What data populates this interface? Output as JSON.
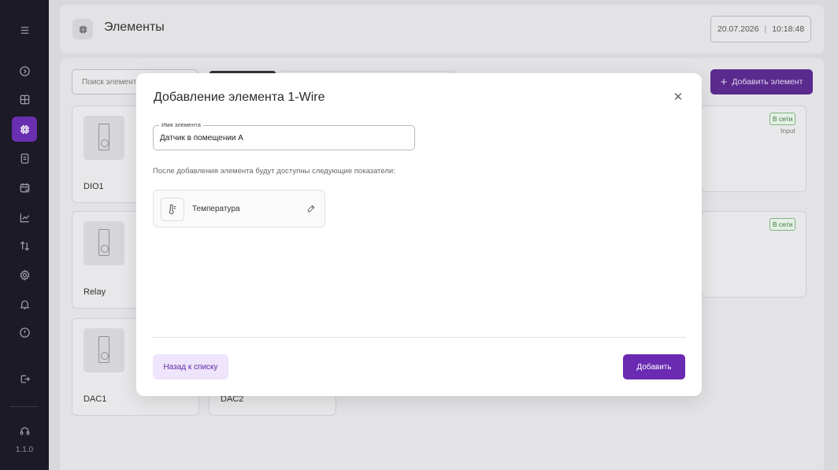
{
  "sidebar": {
    "items": [
      {
        "icon": "menu-icon"
      },
      {
        "icon": "arrow-circle-icon"
      },
      {
        "icon": "dashboard-icon"
      },
      {
        "icon": "chip-icon",
        "active": true
      },
      {
        "icon": "document-icon"
      },
      {
        "icon": "calendar-icon"
      },
      {
        "icon": "chart-icon"
      },
      {
        "icon": "transfer-icon"
      },
      {
        "icon": "settings-icon"
      },
      {
        "icon": "bell-icon"
      },
      {
        "icon": "info-icon"
      },
      {
        "icon": "logout-icon"
      },
      {
        "icon": "support-icon"
      }
    ],
    "version": "1.1.0"
  },
  "header": {
    "title": "Элементы",
    "date": "20.07.2026",
    "time": "10:18:48"
  },
  "toolbar": {
    "search_placeholder": "Поиск элемент",
    "add_label": "Добавить элемент"
  },
  "cards": [
    {
      "name": "DIO1"
    },
    {
      "name": "Relay"
    },
    {
      "name": "DAC1"
    },
    {
      "name": "DAC2"
    }
  ],
  "side_cards": [
    {
      "status": "В сети",
      "io": "Input"
    },
    {
      "status": "В сети",
      "io": ""
    }
  ],
  "modal": {
    "title": "Добавление элемента 1-Wire",
    "field_label": "Имя элемента",
    "field_value": "Датчик в помещении А",
    "hint": "После добавления элемента будут доступны следующие показатели:",
    "metric_name": "Температура",
    "back_label": "Назад к списку",
    "submit_label": "Добавить"
  },
  "colors": {
    "accent": "#6a2bb2",
    "sidebar_bg": "#1c1a26",
    "online": "#3f7a44"
  }
}
